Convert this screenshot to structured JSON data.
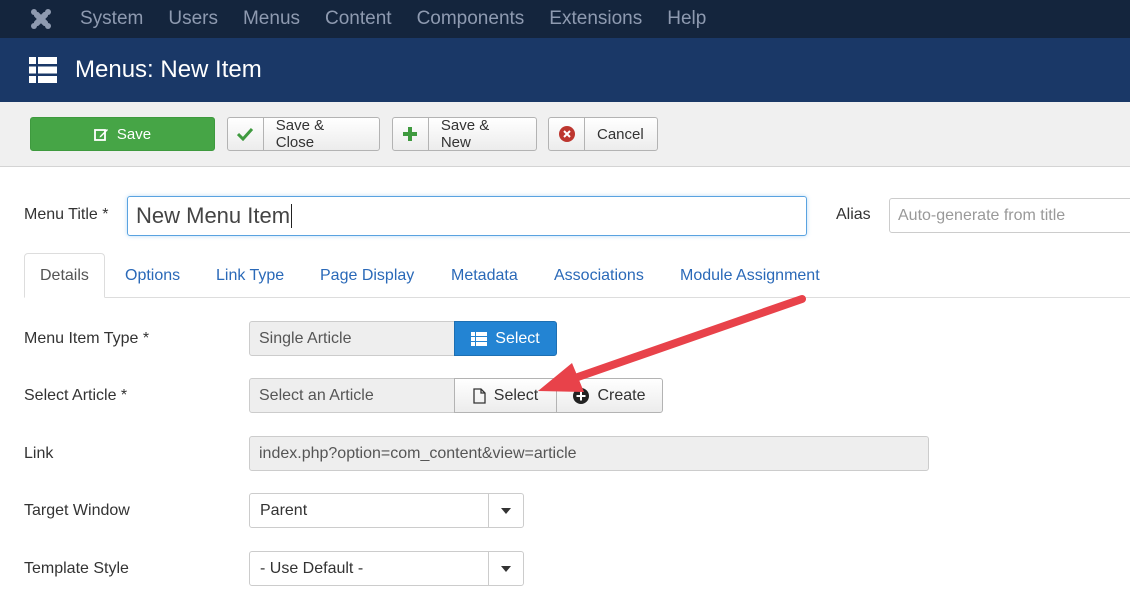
{
  "navbar": {
    "items": [
      "System",
      "Users",
      "Menus",
      "Content",
      "Components",
      "Extensions",
      "Help"
    ]
  },
  "header": {
    "title": "Menus: New Item"
  },
  "toolbar": {
    "save": "Save",
    "save_close": "Save & Close",
    "save_new": "Save & New",
    "cancel": "Cancel"
  },
  "form": {
    "menu_title_label": "Menu Title *",
    "menu_title_value": "New Menu Item",
    "alias_label": "Alias",
    "alias_placeholder": "Auto-generate from title"
  },
  "tabs": [
    "Details",
    "Options",
    "Link Type",
    "Page Display",
    "Metadata",
    "Associations",
    "Module Assignment"
  ],
  "details": {
    "menu_item_type_label": "Menu Item Type *",
    "menu_item_type_value": "Single Article",
    "menu_item_type_button": "Select",
    "select_article_label": "Select Article *",
    "select_article_value": "Select an Article",
    "select_article_button": "Select",
    "create_button": "Create",
    "link_label": "Link",
    "link_value": "index.php?option=com_content&view=article",
    "target_window_label": "Target Window",
    "target_window_value": "Parent",
    "template_style_label": "Template Style",
    "template_style_value": "- Use Default -"
  },
  "colors": {
    "navbar": "#14253d",
    "header": "#1a3867",
    "save_green": "#46a546",
    "select_blue": "#2384d3",
    "link_blue": "#2a69b8",
    "annotation_arrow": "#e8424a"
  }
}
